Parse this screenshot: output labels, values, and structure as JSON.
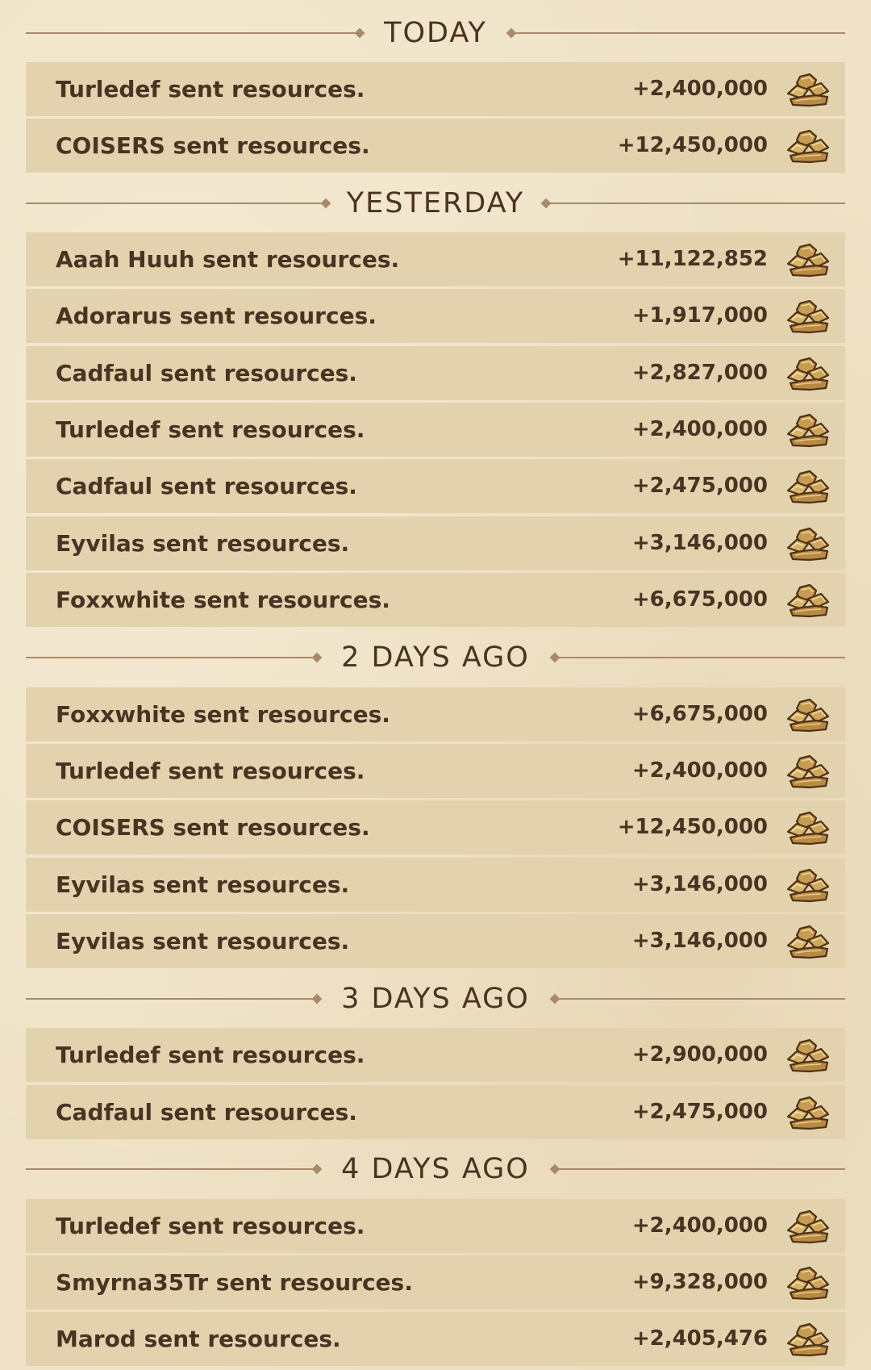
{
  "sections": [
    {
      "title": "TODAY",
      "rows": [
        {
          "text": "Turledef sent resources.",
          "amount": "+2,400,000",
          "icon": "resources-pile-icon"
        },
        {
          "text": "COISERS sent resources.",
          "amount": "+12,450,000",
          "icon": "resources-pile-icon"
        }
      ]
    },
    {
      "title": "YESTERDAY",
      "rows": [
        {
          "text": "Aaah Huuh sent resources.",
          "amount": "+11,122,852",
          "icon": "resources-pile-icon"
        },
        {
          "text": "Adorarus sent resources.",
          "amount": "+1,917,000",
          "icon": "resources-pile-icon"
        },
        {
          "text": "Cadfaul sent resources.",
          "amount": "+2,827,000",
          "icon": "resources-pile-icon"
        },
        {
          "text": "Turledef sent resources.",
          "amount": "+2,400,000",
          "icon": "resources-pile-icon"
        },
        {
          "text": "Cadfaul sent resources.",
          "amount": "+2,475,000",
          "icon": "resources-pile-icon"
        },
        {
          "text": "Eyvilas sent resources.",
          "amount": "+3,146,000",
          "icon": "resources-pile-icon"
        },
        {
          "text": "Foxxwhite sent resources.",
          "amount": "+6,675,000",
          "icon": "resources-pile-icon"
        }
      ]
    },
    {
      "title": "2 DAYS AGO",
      "rows": [
        {
          "text": "Foxxwhite sent resources.",
          "amount": "+6,675,000",
          "icon": "resources-pile-icon"
        },
        {
          "text": "Turledef sent resources.",
          "amount": "+2,400,000",
          "icon": "resources-pile-icon"
        },
        {
          "text": "COISERS sent resources.",
          "amount": "+12,450,000",
          "icon": "resources-pile-icon"
        },
        {
          "text": "Eyvilas sent resources.",
          "amount": "+3,146,000",
          "icon": "resources-pile-icon"
        },
        {
          "text": "Eyvilas sent resources.",
          "amount": "+3,146,000",
          "icon": "resources-pile-icon"
        }
      ]
    },
    {
      "title": "3 DAYS AGO",
      "rows": [
        {
          "text": "Turledef sent resources.",
          "amount": "+2,900,000",
          "icon": "resources-pile-icon"
        },
        {
          "text": "Cadfaul sent resources.",
          "amount": "+2,475,000",
          "icon": "resources-pile-icon"
        }
      ]
    },
    {
      "title": "4 DAYS AGO",
      "rows": [
        {
          "text": "Turledef sent resources.",
          "amount": "+2,400,000",
          "icon": "resources-pile-icon"
        },
        {
          "text": "Smyrna35Tr sent resources.",
          "amount": "+9,328,000",
          "icon": "resources-pile-icon"
        },
        {
          "text": "Marod sent resources.",
          "amount": "+2,405,476",
          "icon": "resources-pile-icon"
        }
      ]
    }
  ],
  "colors": {
    "background": "#efe2c6",
    "row": "#e3d2ae",
    "text": "#4a3322",
    "divider": "#a88a6a"
  }
}
